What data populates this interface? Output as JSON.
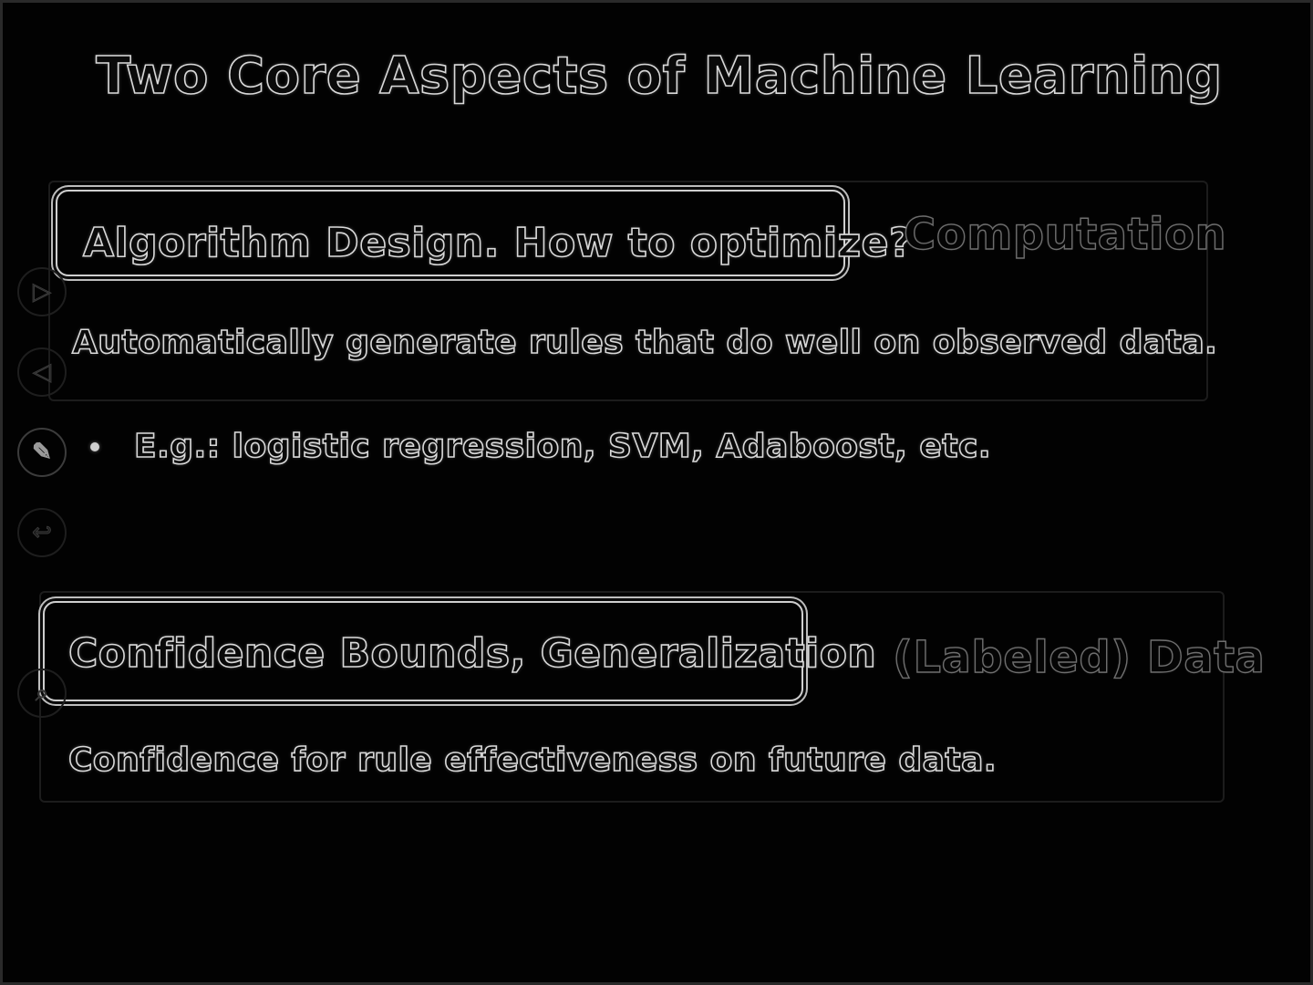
{
  "slide": {
    "title": "Two Core Aspects of Machine Learning",
    "section_1": {
      "heading": "Algorithm Design. How to optimize?",
      "side_label": "Computation",
      "description": "Automatically generate rules that do well on observed data.",
      "bullet": "E.g.: logistic regression, SVM, Adaboost, etc."
    },
    "section_2": {
      "heading": "Confidence Bounds, Generalization",
      "side_label": "(Labeled) Data",
      "description": "Confidence for rule effectiveness on future data."
    }
  },
  "controls": {
    "icons": [
      "play-icon",
      "back-icon",
      "pen-icon",
      "return-icon",
      "search-icon"
    ],
    "glyphs": [
      "▷",
      "◁",
      "✎",
      "↩",
      "⌕"
    ]
  },
  "colors": {
    "background": "#000000",
    "text_outline": "#d9d9d9",
    "dim_outline": "#6e6e6e"
  }
}
